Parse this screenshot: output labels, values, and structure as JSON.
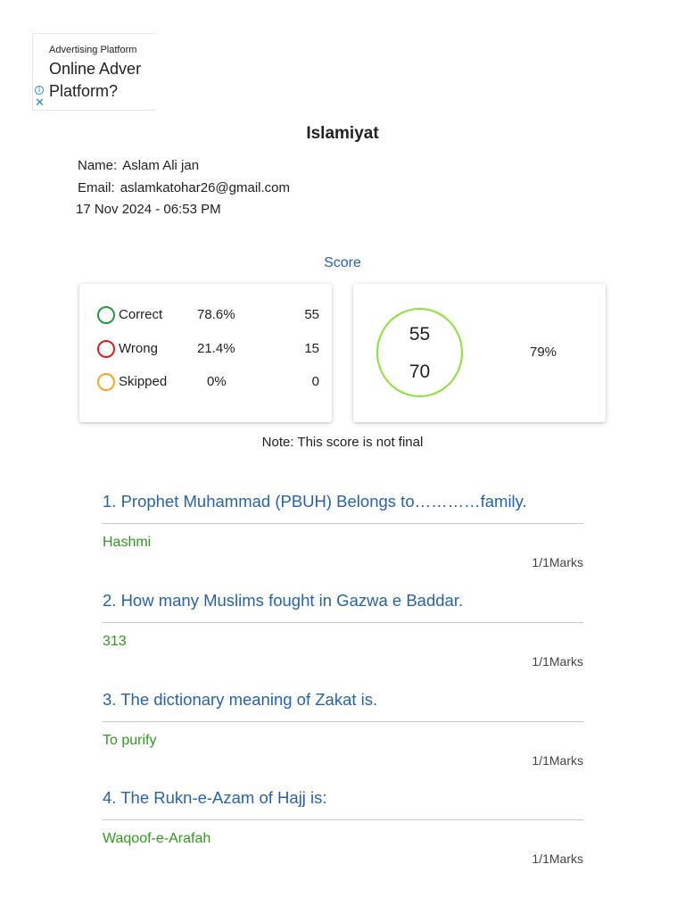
{
  "ad": {
    "small_text": "Advertising Platform",
    "headline_line1": "Online Adver",
    "headline_line2": "Platform?",
    "info_glyph": "i",
    "close_glyph": "✕"
  },
  "title": "Islamiyat",
  "user": {
    "name_label": "Name:",
    "name_value": "Aslam Ali jan",
    "email_label": "Email:",
    "email_value": "aslamkatohar26@gmail.com",
    "datetime": "17 Nov 2024 - 06:53 PM"
  },
  "score": {
    "heading": "Score",
    "rows": [
      {
        "label": "Correct",
        "percent": "78.6%",
        "count": "55",
        "color": "#1f9d3a"
      },
      {
        "label": "Wrong",
        "percent": "21.4%",
        "count": "15",
        "color": "#e01b1b"
      },
      {
        "label": "Skipped",
        "percent": "0%",
        "count": "0",
        "color": "#f5a623"
      }
    ],
    "obtained": "55",
    "total": "70",
    "overall_percent": "79%",
    "circle_color": "#8be236",
    "note": "Note: This score is not final"
  },
  "questions": [
    {
      "text": "1. Prophet Muhammad (PBUH) Belongs to…………family.",
      "answer": "Hashmi",
      "marks": "1/1Marks"
    },
    {
      "text": "2. How many Muslims fought in Gazwa e Baddar.",
      "answer": "313",
      "marks": "1/1Marks"
    },
    {
      "text": "3. The dictionary meaning of Zakat is.",
      "answer": "To purify",
      "marks": "1/1Marks"
    },
    {
      "text": "4. The Rukn-e-Azam of Hajj is:",
      "answer": "Waqoof-e-Arafah",
      "marks": "1/1Marks"
    }
  ],
  "colors": {
    "accent_blue": "#2563b0",
    "answer_green": "#2e9a1c"
  }
}
